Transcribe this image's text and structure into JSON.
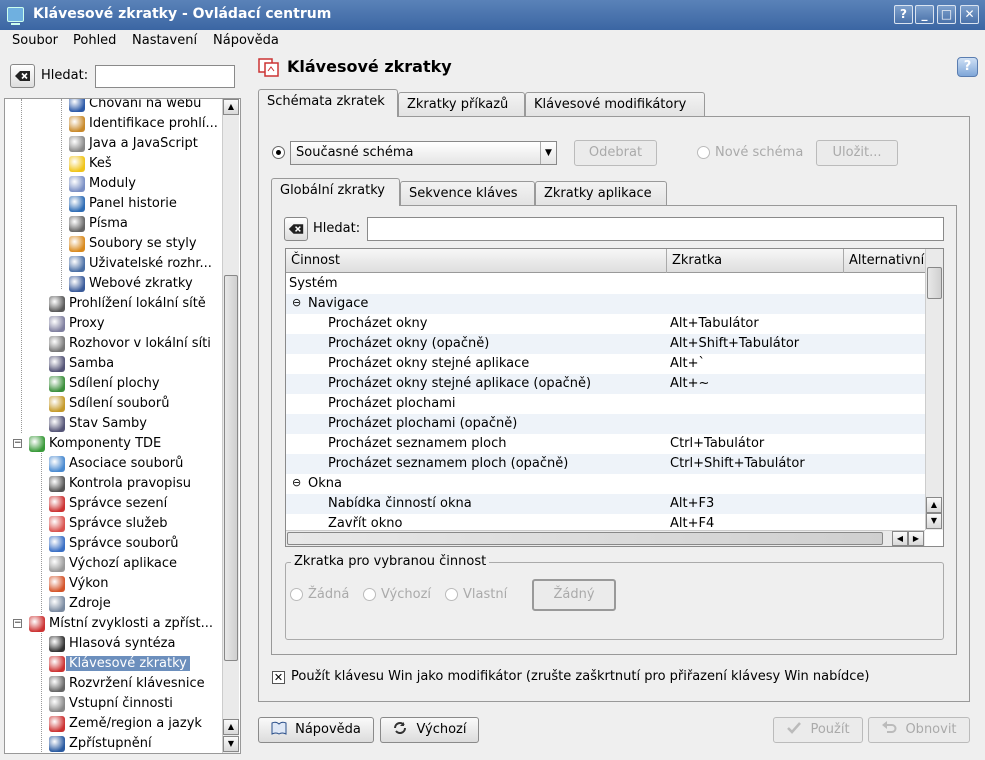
{
  "window": {
    "title": "Klávesové zkratky - Ovládací centrum",
    "buttons": {
      "help": "?",
      "minimize": "_",
      "maximize": "□",
      "close": "✕"
    }
  },
  "menubar": [
    "Soubor",
    "Pohled",
    "Nastavení",
    "Nápověda"
  ],
  "sidebar": {
    "search_label": "Hledat:",
    "search_value": "",
    "items": [
      {
        "label": "Chování na webu",
        "icon": "globe-icon",
        "color": "#2d5aa8"
      },
      {
        "label": "Identifikace prohlí...",
        "icon": "user-agent-icon",
        "color": "#c98a2b"
      },
      {
        "label": "Java a JavaScript",
        "icon": "java-icon",
        "color": "#888888"
      },
      {
        "label": "Keš",
        "icon": "cache-icon",
        "color": "#f0c419"
      },
      {
        "label": "Moduly",
        "icon": "plugin-icon",
        "color": "#7a8fc4"
      },
      {
        "label": "Panel historie",
        "icon": "history-icon",
        "color": "#2f6db5"
      },
      {
        "label": "Písma",
        "icon": "font-icon",
        "color": "#666666"
      },
      {
        "label": "Soubory se styly",
        "icon": "css-icon",
        "color": "#d98a1e"
      },
      {
        "label": "Uživatelské rozhr...",
        "icon": "ui-icon",
        "color": "#4a6fa5"
      },
      {
        "label": "Webové zkratky",
        "icon": "web-shortcut-icon",
        "color": "#3a5b9a"
      },
      {
        "label": "Prohlížení lokální sítě",
        "icon": "network-browse-icon",
        "color": "#5a5a5a"
      },
      {
        "label": "Proxy",
        "icon": "proxy-icon",
        "color": "#7f7f9f"
      },
      {
        "label": "Rozhovor v lokální síti",
        "icon": "lan-talk-icon",
        "color": "#777777"
      },
      {
        "label": "Samba",
        "icon": "samba-icon",
        "color": "#555577"
      },
      {
        "label": "Sdílení plochy",
        "icon": "desktop-sharing-icon",
        "color": "#3c8f3c"
      },
      {
        "label": "Sdílení souborů",
        "icon": "file-sharing-icon",
        "color": "#c59a2a"
      },
      {
        "label": "Stav Samby",
        "icon": "samba-status-icon",
        "color": "#555577"
      },
      {
        "label": "Komponenty TDE",
        "icon": "components-icon",
        "color": "#3a9a3a"
      },
      {
        "label": "Asociace souborů",
        "icon": "file-assoc-icon",
        "color": "#4a8ad0"
      },
      {
        "label": "Kontrola pravopisu",
        "icon": "spellcheck-icon",
        "color": "#555555"
      },
      {
        "label": "Správce sezení",
        "icon": "session-icon",
        "color": "#cc3333"
      },
      {
        "label": "Správce služeb",
        "icon": "services-icon",
        "color": "#d9534f"
      },
      {
        "label": "Správce souborů",
        "icon": "file-manager-icon",
        "color": "#3a6fc4"
      },
      {
        "label": "Výchozí aplikace",
        "icon": "default-apps-icon",
        "color": "#999999"
      },
      {
        "label": "Výkon",
        "icon": "performance-icon",
        "color": "#d4552b"
      },
      {
        "label": "Zdroje",
        "icon": "resources-icon",
        "color": "#7a8aa0"
      },
      {
        "label": "Místní zvyklosti a zpříst...",
        "icon": "locale-icon",
        "color": "#cc3333"
      },
      {
        "label": "Hlasová syntéza",
        "icon": "speech-icon",
        "color": "#333333"
      },
      {
        "label": "Klávesové zkratky",
        "icon": "keyboard-shortcuts-icon",
        "color": "#cc3333"
      },
      {
        "label": "Rozvržení klávesnice",
        "icon": "keyboard-layout-icon",
        "color": "#666666"
      },
      {
        "label": "Vstupní činnosti",
        "icon": "input-actions-icon",
        "color": "#888888"
      },
      {
        "label": "Země/region a jazyk",
        "icon": "country-icon",
        "color": "#cc3333"
      },
      {
        "label": "Zpřístupnění",
        "icon": "accessibility-icon",
        "color": "#2a5aa0"
      }
    ]
  },
  "page": {
    "title": "Klávesové zkratky",
    "help_icon": "?",
    "tabs": [
      "Schémata zkratek",
      "Zkratky příkazů",
      "Klávesové modifikátory"
    ],
    "scheme": {
      "current": "Současné schéma",
      "remove": "Odebrat",
      "new_scheme": "Nové schéma",
      "save": "Uložit..."
    },
    "subtabs": [
      "Globální zkratky",
      "Sekvence kláves",
      "Zkratky aplikace"
    ],
    "search_label": "Hledat:",
    "search_value": "",
    "columns": [
      "Činnost",
      "Zkratka",
      "Alternativní"
    ],
    "rows": [
      {
        "action": "Systém",
        "shortcut": "",
        "level": 0
      },
      {
        "action": "Navigace",
        "shortcut": "",
        "level": 1,
        "expander": "⊖"
      },
      {
        "action": "Procházet okny",
        "shortcut": "Alt+Tabulátor",
        "level": 2
      },
      {
        "action": "Procházet okny (opačně)",
        "shortcut": "Alt+Shift+Tabulátor",
        "level": 2
      },
      {
        "action": "Procházet okny stejné aplikace",
        "shortcut": "Alt+`",
        "level": 2
      },
      {
        "action": "Procházet okny stejné aplikace (opačně)",
        "shortcut": "Alt+~",
        "level": 2
      },
      {
        "action": "Procházet plochami",
        "shortcut": "",
        "level": 2
      },
      {
        "action": "Procházet plochami (opačně)",
        "shortcut": "",
        "level": 2
      },
      {
        "action": "Procházet seznamem ploch",
        "shortcut": "Ctrl+Tabulátor",
        "level": 2
      },
      {
        "action": "Procházet seznamem ploch (opačně)",
        "shortcut": "Ctrl+Shift+Tabulátor",
        "level": 2
      },
      {
        "action": "Okna",
        "shortcut": "",
        "level": 1,
        "expander": "⊖"
      },
      {
        "action": "Nabídka činností okna",
        "shortcut": "Alt+F3",
        "level": 2
      },
      {
        "action": "Zavřít okno",
        "shortcut": "Alt+F4",
        "level": 2
      }
    ],
    "group": {
      "title": "Zkratka pro vybranou činnost",
      "none": "Žádná",
      "default": "Výchozí",
      "custom": "Vlastní",
      "button": "Žádný"
    },
    "win_modifier": "Použít klávesu Win jako modifikátor (zrušte zaškrtnutí pro přiřazení klávesy Win nabídce)",
    "win_checked": "✕"
  },
  "bottom": {
    "help": "Nápověda",
    "defaults": "Výchozí",
    "apply": "Použít",
    "reset": "Obnovit"
  }
}
